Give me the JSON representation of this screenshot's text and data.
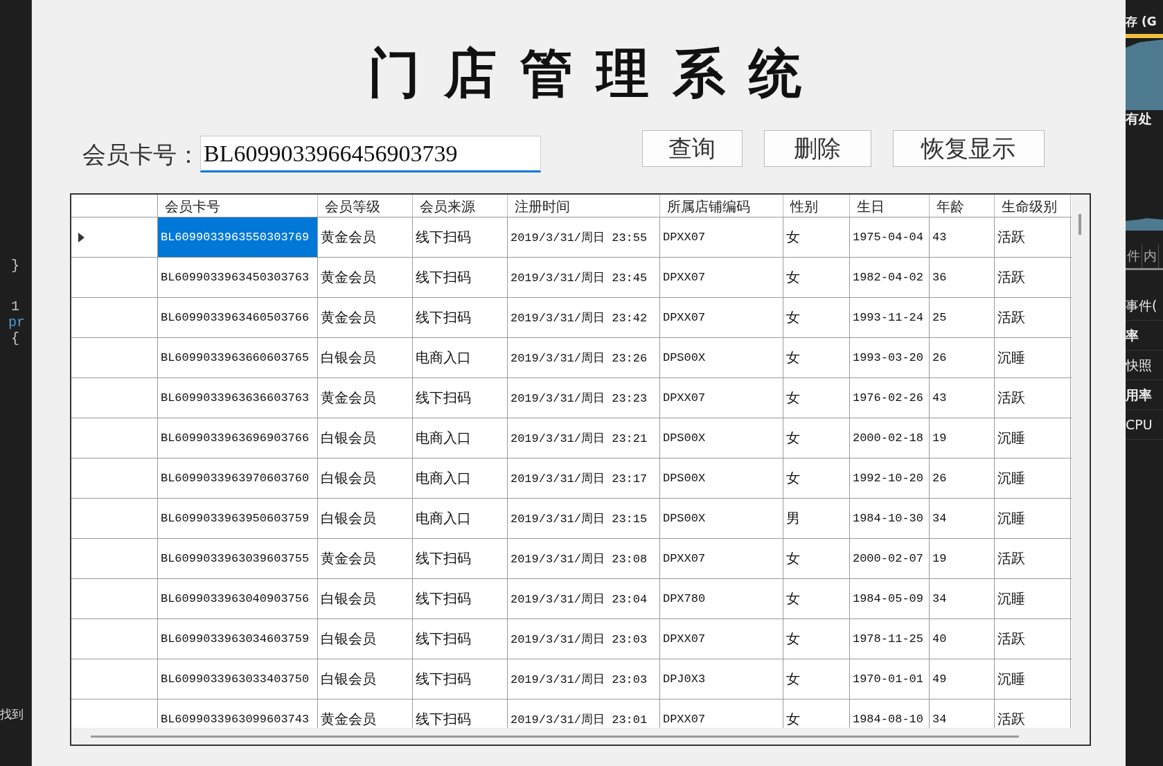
{
  "editor_fragments": [
    {
      "text": "}"
    },
    {
      "text": "1"
    },
    {
      "text": "pr"
    },
    {
      "text": "{"
    },
    {
      "text": "找到"
    }
  ],
  "title": "门店管理系统",
  "search": {
    "label": "会员卡号：",
    "value": "BL6099033966456903739"
  },
  "buttons": [
    "查询",
    "删除",
    "恢复显示"
  ],
  "table": {
    "columns": [
      "会员卡号",
      "会员等级",
      "会员来源",
      "注册时间",
      "所属店铺编码",
      "性别",
      "生日",
      "年龄",
      "生命级别"
    ],
    "rows": [
      {
        "selected": true,
        "cells": [
          "BL6099033963550303769",
          "黄金会员",
          "线下扫码",
          "2019/3/31/周日 23:55",
          "DPXX07",
          "女",
          "1975-04-04",
          "43",
          "活跃"
        ]
      },
      {
        "selected": false,
        "cells": [
          "BL6099033963450303763",
          "黄金会员",
          "线下扫码",
          "2019/3/31/周日 23:45",
          "DPXX07",
          "女",
          "1982-04-02",
          "36",
          "活跃"
        ]
      },
      {
        "selected": false,
        "cells": [
          "BL6099033963460503766",
          "黄金会员",
          "线下扫码",
          "2019/3/31/周日 23:42",
          "DPXX07",
          "女",
          "1993-11-24",
          "25",
          "活跃"
        ]
      },
      {
        "selected": false,
        "cells": [
          "BL6099033963660603765",
          "白银会员",
          "电商入口",
          "2019/3/31/周日 23:26",
          "DPS00X",
          "女",
          "1993-03-20",
          "26",
          "沉睡"
        ]
      },
      {
        "selected": false,
        "cells": [
          "BL6099033963636603763",
          "黄金会员",
          "线下扫码",
          "2019/3/31/周日 23:23",
          "DPXX07",
          "女",
          "1976-02-26",
          "43",
          "活跃"
        ]
      },
      {
        "selected": false,
        "cells": [
          "BL6099033963696903766",
          "白银会员",
          "电商入口",
          "2019/3/31/周日 23:21",
          "DPS00X",
          "女",
          "2000-02-18",
          "19",
          "沉睡"
        ]
      },
      {
        "selected": false,
        "cells": [
          "BL6099033963970603760",
          "白银会员",
          "电商入口",
          "2019/3/31/周日 23:17",
          "DPS00X",
          "女",
          "1992-10-20",
          "26",
          "沉睡"
        ]
      },
      {
        "selected": false,
        "cells": [
          "BL6099033963950603759",
          "白银会员",
          "电商入口",
          "2019/3/31/周日 23:15",
          "DPS00X",
          "男",
          "1984-10-30",
          "34",
          "沉睡"
        ]
      },
      {
        "selected": false,
        "cells": [
          "BL6099033963039603755",
          "黄金会员",
          "线下扫码",
          "2019/3/31/周日 23:08",
          "DPXX07",
          "女",
          "2000-02-07",
          "19",
          "活跃"
        ]
      },
      {
        "selected": false,
        "cells": [
          "BL6099033963040903756",
          "白银会员",
          "线下扫码",
          "2019/3/31/周日 23:04",
          "DPX780",
          "女",
          "1984-05-09",
          "34",
          "沉睡"
        ]
      },
      {
        "selected": false,
        "cells": [
          "BL6099033963034603759",
          "白银会员",
          "线下扫码",
          "2019/3/31/周日 23:03",
          "DPXX07",
          "女",
          "1978-11-25",
          "40",
          "活跃"
        ]
      },
      {
        "selected": false,
        "cells": [
          "BL6099033963033403750",
          "白银会员",
          "线下扫码",
          "2019/3/31/周日 23:03",
          "DPJ0X3",
          "女",
          "1970-01-01",
          "49",
          "沉睡"
        ]
      },
      {
        "selected": false,
        "cells": [
          "BL6099033963099603743",
          "黄金会员",
          "线下扫码",
          "2019/3/31/周日 23:01",
          "DPXX07",
          "女",
          "1984-08-10",
          "34",
          "活跃"
        ]
      }
    ]
  },
  "monitor_panel": {
    "top_labels": [
      "存 (G",
      "有处"
    ],
    "tabs": [
      "件",
      "内"
    ],
    "list": [
      "事件(",
      "率",
      "快照",
      "用率",
      "CPU"
    ]
  }
}
